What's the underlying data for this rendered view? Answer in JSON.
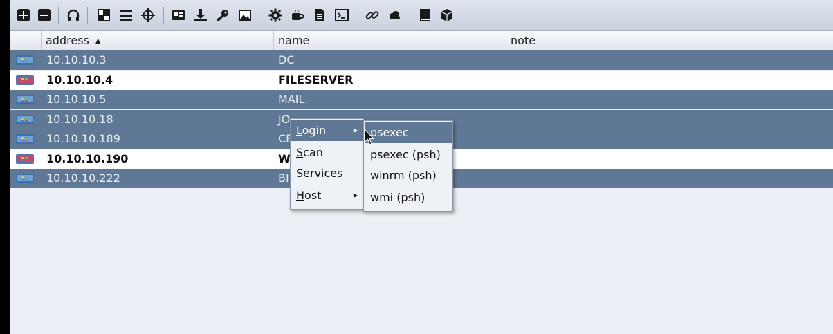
{
  "toolbar": {
    "icons": [
      "add-icon",
      "remove-icon",
      "headphones-icon",
      "grid-icon",
      "list-icon",
      "target-icon",
      "card-icon",
      "download-icon",
      "key-icon",
      "image-icon",
      "gear-icon",
      "coffee-icon",
      "document-icon",
      "terminal-icon",
      "link-icon",
      "cloud-icon",
      "book-icon",
      "package-icon"
    ]
  },
  "table": {
    "columns": [
      {
        "label": "address"
      },
      {
        "label": "name"
      },
      {
        "label": "note"
      }
    ],
    "rows": [
      {
        "address": "10.10.10.3",
        "name": "DC",
        "selected": true,
        "os": "windows"
      },
      {
        "address": "10.10.10.4",
        "name": "FILESERVER",
        "selected": false,
        "os": "windows"
      },
      {
        "address": "10.10.10.5",
        "name": "MAIL",
        "selected": true,
        "os": "windows"
      },
      {
        "address": "10.10.10.18",
        "name": "JO",
        "selected": true,
        "os": "windows"
      },
      {
        "address": "10.10.10.189",
        "name": "CE",
        "selected": true,
        "os": "windows"
      },
      {
        "address": "10.10.10.190",
        "name": "W",
        "selected": false,
        "os": "windows"
      },
      {
        "address": "10.10.10.222",
        "name": "BI",
        "selected": true,
        "os": "windows"
      }
    ]
  },
  "context_menu": {
    "items": [
      {
        "pre": "",
        "mn": "L",
        "post": "ogin",
        "has_submenu": true,
        "active": true
      },
      {
        "pre": "",
        "mn": "S",
        "post": "can",
        "has_submenu": false,
        "active": false
      },
      {
        "pre": "Ser",
        "mn": "v",
        "post": "ices",
        "has_submenu": false,
        "active": false
      },
      {
        "pre": "",
        "mn": "H",
        "post": "ost",
        "has_submenu": true,
        "active": false
      }
    ]
  },
  "submenu": {
    "items": [
      {
        "label": "psexec",
        "active": true
      },
      {
        "label": "psexec (psh)",
        "active": false
      },
      {
        "label": "winrm (psh)",
        "active": false
      },
      {
        "label": "wmi (psh)",
        "active": false
      }
    ]
  },
  "colors": {
    "selected_row": "#5f7896",
    "toolbar": "#d5dbe5",
    "background": "#eceff5"
  }
}
